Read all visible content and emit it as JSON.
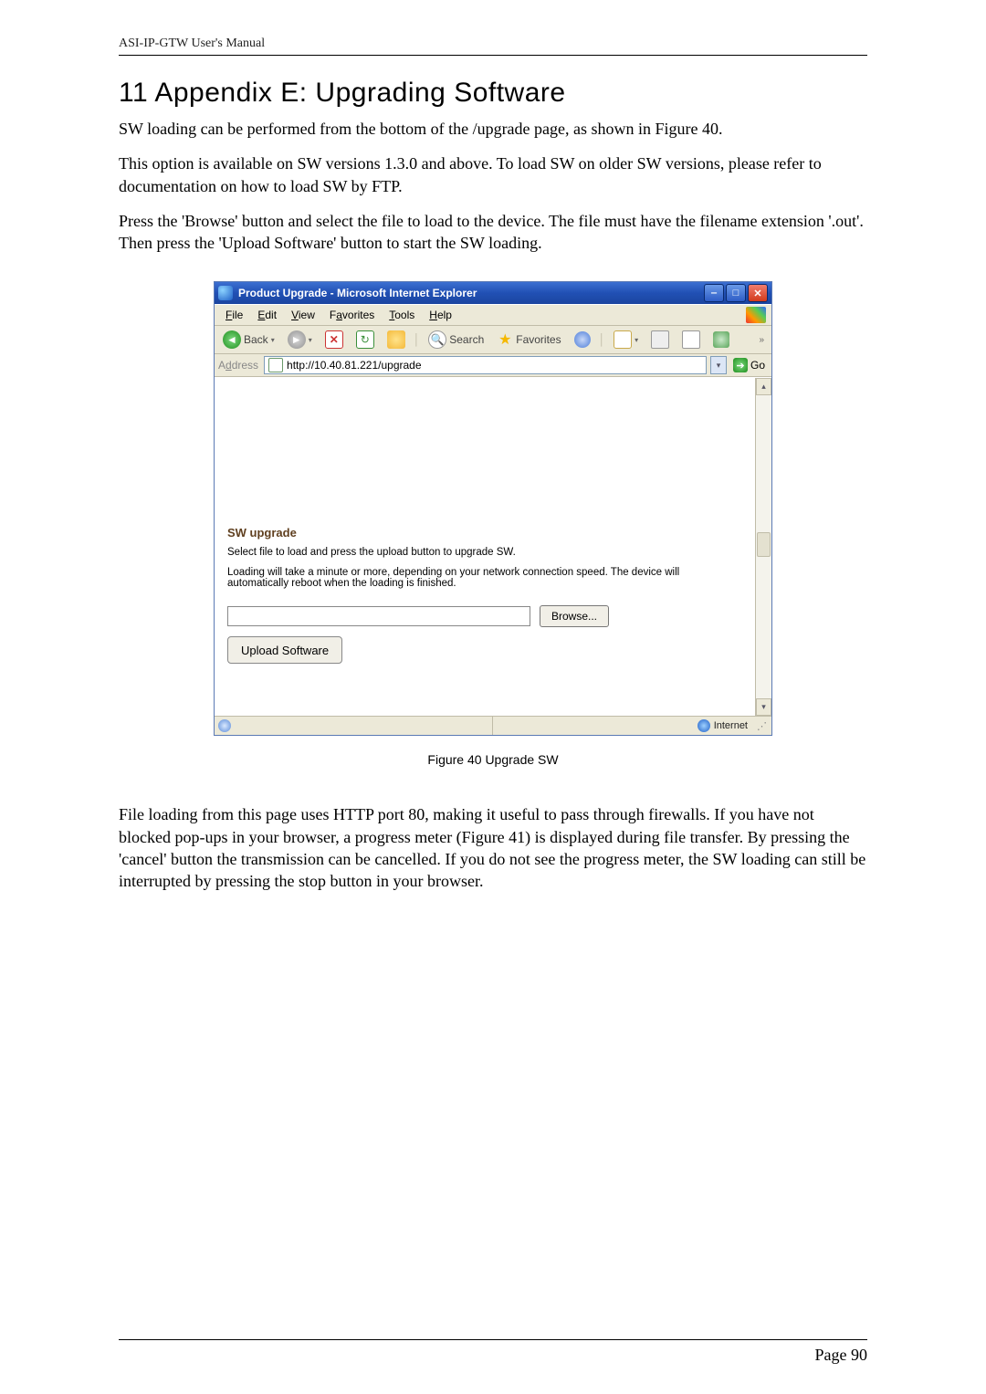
{
  "header": "ASI-IP-GTW User's Manual",
  "title": "11 Appendix E: Upgrading Software",
  "p1": "SW loading can be performed from the bottom of the /upgrade page, as shown in Figure 40.",
  "p2": "This option is available on SW versions 1.3.0 and above. To load SW on older SW versions, please refer to documentation on how to load SW by FTP.",
  "p3": "Press the 'Browse' button and select the file to load to the device. The file must have the filename extension '.out'. Then press the 'Upload Software' button to start the SW loading.",
  "ie": {
    "title": "Product Upgrade - Microsoft Internet Explorer",
    "menus": {
      "file": "File",
      "edit": "Edit",
      "view": "View",
      "fav": "Favorites",
      "tools": "Tools",
      "help": "Help"
    },
    "toolbar": {
      "back": "Back",
      "search": "Search",
      "favorites": "Favorites"
    },
    "addr_label": "Address",
    "url": "http://10.40.81.221/upgrade",
    "go": "Go",
    "section": "SW upgrade",
    "line1": "Select file to load and press the upload button to upgrade SW.",
    "line2": "Loading will take a minute or more, depending on your network connection speed. The device will automatically reboot when the loading is finished.",
    "browse": "Browse...",
    "upload": "Upload Software",
    "status_zone": "Internet"
  },
  "caption": "Figure 40 Upgrade SW",
  "p4": "File loading from this page uses HTTP port 80, making it useful to pass through firewalls. If you have not blocked pop-ups in your browser, a progress meter (Figure 41) is displayed during file transfer. By pressing the 'cancel' button the transmission can be cancelled. If you do not see the progress meter, the SW loading can still be interrupted by pressing the stop button in your browser.",
  "page_num": "Page 90"
}
